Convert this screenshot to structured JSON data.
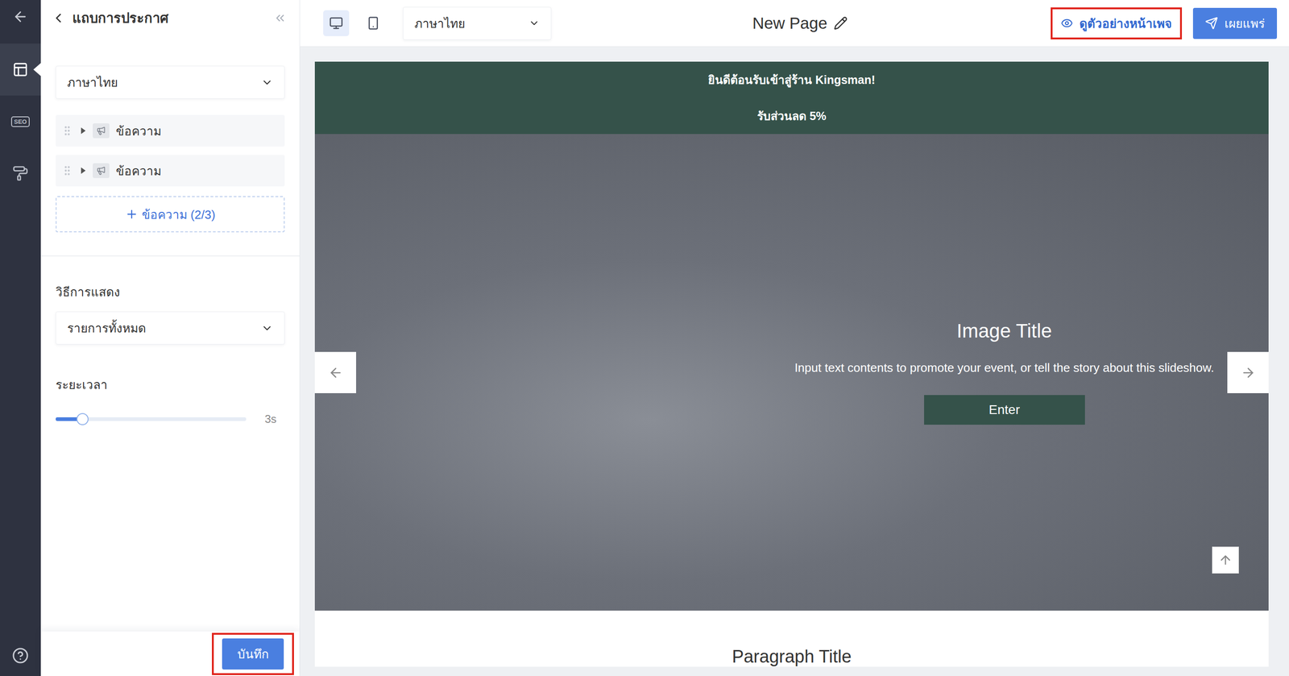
{
  "rail": {
    "items": [
      {
        "kind": "layout",
        "label": "",
        "selected": true
      },
      {
        "kind": "seo",
        "label": "SEO",
        "selected": false
      },
      {
        "kind": "style",
        "label": "",
        "selected": false
      }
    ]
  },
  "panel": {
    "title": "แถบการประกาศ",
    "language": "ภาษาไทย",
    "messages": [
      {
        "label": "ข้อความ",
        "expanded": false
      },
      {
        "label": "ข้อความ",
        "expanded": false
      }
    ],
    "add_button": {
      "label": "ข้อความ (2/3)"
    },
    "display_mode": {
      "label": "วิธีการแสดง",
      "value": "รายการทั้งหมด"
    },
    "duration": {
      "label": "ระยะเวลา",
      "level": 0.14,
      "reading": "3s"
    },
    "save_button": {
      "label": "บันทึก",
      "annotated": true
    }
  },
  "toolbar": {
    "devices": [
      {
        "kind": "desktop",
        "selected": true
      },
      {
        "kind": "mobile",
        "selected": false
      }
    ],
    "language": "ภาษาไทย",
    "page_title": "New Page",
    "preview_button": {
      "label": "ดูตัวอย่างหน้าเพจ",
      "annotated": true
    },
    "publish_button": {
      "label": "เผยแพร่"
    }
  },
  "canvas": {
    "announcement": [
      "ยินดีต้อนรับเข้าสู่ร้าน Kingsman!",
      "รับส่วนลด 5%"
    ],
    "slideshow": {
      "title": "Image Title",
      "text": "Input text contents to promote your event, or tell the story about this slideshow.",
      "button": "Enter"
    },
    "paragraph_title": "Paragraph Title"
  }
}
